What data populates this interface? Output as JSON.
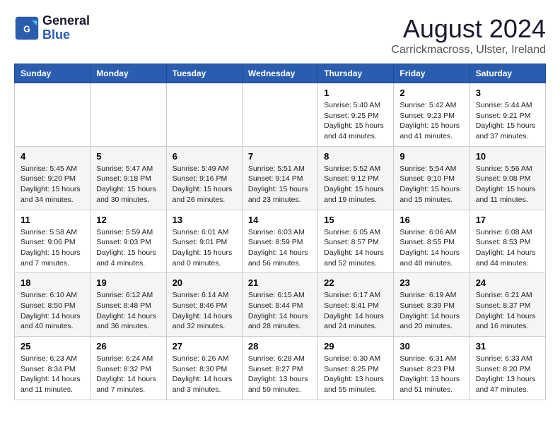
{
  "header": {
    "logo_line1": "General",
    "logo_line2": "Blue",
    "title": "August 2024",
    "subtitle": "Carrickmacross, Ulster, Ireland"
  },
  "calendar": {
    "days_of_week": [
      "Sunday",
      "Monday",
      "Tuesday",
      "Wednesday",
      "Thursday",
      "Friday",
      "Saturday"
    ],
    "weeks": [
      [
        {
          "day": "",
          "info": ""
        },
        {
          "day": "",
          "info": ""
        },
        {
          "day": "",
          "info": ""
        },
        {
          "day": "",
          "info": ""
        },
        {
          "day": "1",
          "info": "Sunrise: 5:40 AM\nSunset: 9:25 PM\nDaylight: 15 hours\nand 44 minutes."
        },
        {
          "day": "2",
          "info": "Sunrise: 5:42 AM\nSunset: 9:23 PM\nDaylight: 15 hours\nand 41 minutes."
        },
        {
          "day": "3",
          "info": "Sunrise: 5:44 AM\nSunset: 9:21 PM\nDaylight: 15 hours\nand 37 minutes."
        }
      ],
      [
        {
          "day": "4",
          "info": "Sunrise: 5:45 AM\nSunset: 9:20 PM\nDaylight: 15 hours\nand 34 minutes."
        },
        {
          "day": "5",
          "info": "Sunrise: 5:47 AM\nSunset: 9:18 PM\nDaylight: 15 hours\nand 30 minutes."
        },
        {
          "day": "6",
          "info": "Sunrise: 5:49 AM\nSunset: 9:16 PM\nDaylight: 15 hours\nand 26 minutes."
        },
        {
          "day": "7",
          "info": "Sunrise: 5:51 AM\nSunset: 9:14 PM\nDaylight: 15 hours\nand 23 minutes."
        },
        {
          "day": "8",
          "info": "Sunrise: 5:52 AM\nSunset: 9:12 PM\nDaylight: 15 hours\nand 19 minutes."
        },
        {
          "day": "9",
          "info": "Sunrise: 5:54 AM\nSunset: 9:10 PM\nDaylight: 15 hours\nand 15 minutes."
        },
        {
          "day": "10",
          "info": "Sunrise: 5:56 AM\nSunset: 9:08 PM\nDaylight: 15 hours\nand 11 minutes."
        }
      ],
      [
        {
          "day": "11",
          "info": "Sunrise: 5:58 AM\nSunset: 9:06 PM\nDaylight: 15 hours\nand 7 minutes."
        },
        {
          "day": "12",
          "info": "Sunrise: 5:59 AM\nSunset: 9:03 PM\nDaylight: 15 hours\nand 4 minutes."
        },
        {
          "day": "13",
          "info": "Sunrise: 6:01 AM\nSunset: 9:01 PM\nDaylight: 15 hours\nand 0 minutes."
        },
        {
          "day": "14",
          "info": "Sunrise: 6:03 AM\nSunset: 8:59 PM\nDaylight: 14 hours\nand 56 minutes."
        },
        {
          "day": "15",
          "info": "Sunrise: 6:05 AM\nSunset: 8:57 PM\nDaylight: 14 hours\nand 52 minutes."
        },
        {
          "day": "16",
          "info": "Sunrise: 6:06 AM\nSunset: 8:55 PM\nDaylight: 14 hours\nand 48 minutes."
        },
        {
          "day": "17",
          "info": "Sunrise: 6:08 AM\nSunset: 8:53 PM\nDaylight: 14 hours\nand 44 minutes."
        }
      ],
      [
        {
          "day": "18",
          "info": "Sunrise: 6:10 AM\nSunset: 8:50 PM\nDaylight: 14 hours\nand 40 minutes."
        },
        {
          "day": "19",
          "info": "Sunrise: 6:12 AM\nSunset: 8:48 PM\nDaylight: 14 hours\nand 36 minutes."
        },
        {
          "day": "20",
          "info": "Sunrise: 6:14 AM\nSunset: 8:46 PM\nDaylight: 14 hours\nand 32 minutes."
        },
        {
          "day": "21",
          "info": "Sunrise: 6:15 AM\nSunset: 8:44 PM\nDaylight: 14 hours\nand 28 minutes."
        },
        {
          "day": "22",
          "info": "Sunrise: 6:17 AM\nSunset: 8:41 PM\nDaylight: 14 hours\nand 24 minutes."
        },
        {
          "day": "23",
          "info": "Sunrise: 6:19 AM\nSunset: 8:39 PM\nDaylight: 14 hours\nand 20 minutes."
        },
        {
          "day": "24",
          "info": "Sunrise: 6:21 AM\nSunset: 8:37 PM\nDaylight: 14 hours\nand 16 minutes."
        }
      ],
      [
        {
          "day": "25",
          "info": "Sunrise: 6:23 AM\nSunset: 8:34 PM\nDaylight: 14 hours\nand 11 minutes."
        },
        {
          "day": "26",
          "info": "Sunrise: 6:24 AM\nSunset: 8:32 PM\nDaylight: 14 hours\nand 7 minutes."
        },
        {
          "day": "27",
          "info": "Sunrise: 6:26 AM\nSunset: 8:30 PM\nDaylight: 14 hours\nand 3 minutes."
        },
        {
          "day": "28",
          "info": "Sunrise: 6:28 AM\nSunset: 8:27 PM\nDaylight: 13 hours\nand 59 minutes."
        },
        {
          "day": "29",
          "info": "Sunrise: 6:30 AM\nSunset: 8:25 PM\nDaylight: 13 hours\nand 55 minutes."
        },
        {
          "day": "30",
          "info": "Sunrise: 6:31 AM\nSunset: 8:23 PM\nDaylight: 13 hours\nand 51 minutes."
        },
        {
          "day": "31",
          "info": "Sunrise: 6:33 AM\nSunset: 8:20 PM\nDaylight: 13 hours\nand 47 minutes."
        }
      ]
    ]
  }
}
